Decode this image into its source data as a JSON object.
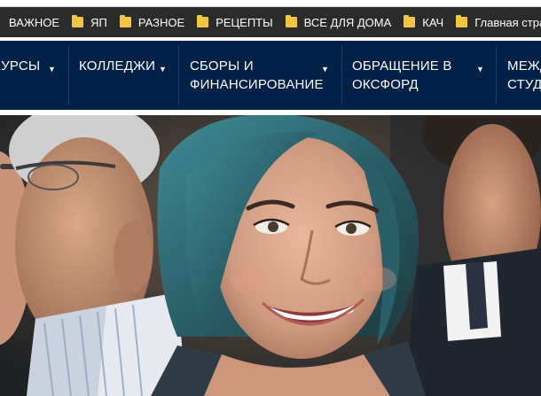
{
  "bookmarks_bar": {
    "items": [
      {
        "label": "ВАЖНОЕ",
        "folder": false
      },
      {
        "label": "ЯП",
        "folder": true
      },
      {
        "label": "РАЗНОЕ",
        "folder": true
      },
      {
        "label": "РЕЦЕПТЫ",
        "folder": true
      },
      {
        "label": "ВСЕ ДЛЯ ДОМА",
        "folder": true
      },
      {
        "label": "КАЧ",
        "folder": true
      },
      {
        "label": "Главная страниц",
        "folder": true
      }
    ]
  },
  "navbar": {
    "items": [
      {
        "line1": "КУРСЫ",
        "line2": ""
      },
      {
        "line1": "КОЛЛЕДЖИ",
        "line2": ""
      },
      {
        "line1": "СБОРЫ И",
        "line2": "ФИНАНСИРОВАНИЕ"
      },
      {
        "line1": "ОБРАЩЕНИЕ В",
        "line2": "ОКСФОРД"
      },
      {
        "line1": "МЕЖД",
        "line2": "СТУД"
      }
    ],
    "caret": "▼"
  },
  "colors": {
    "navbar_bg": "#002147",
    "bookmarks_bg": "#2b2b2b",
    "folder": "#f5c542"
  },
  "hero": {
    "image": "smiling-student-photo"
  }
}
